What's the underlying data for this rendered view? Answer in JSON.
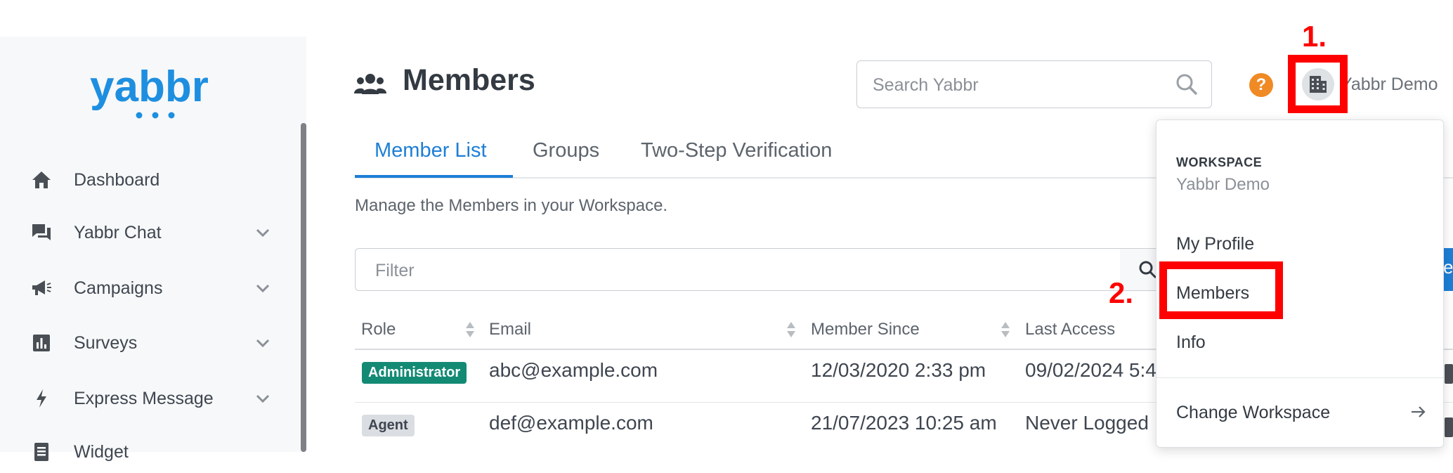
{
  "app": {
    "logo_text": "yabbr"
  },
  "sidebar": {
    "items": [
      {
        "label": "Dashboard",
        "icon": "home-icon",
        "has_chevron": false
      },
      {
        "label": "Yabbr Chat",
        "icon": "chat-icon",
        "has_chevron": true
      },
      {
        "label": "Campaigns",
        "icon": "megaphone-icon",
        "has_chevron": true
      },
      {
        "label": "Surveys",
        "icon": "bar-chart-icon",
        "has_chevron": true
      },
      {
        "label": "Express Message",
        "icon": "lightning-icon",
        "has_chevron": true
      },
      {
        "label": "Widget",
        "icon": "document-icon",
        "has_chevron": false
      }
    ]
  },
  "header": {
    "title": "Members",
    "search_placeholder": "Search Yabbr",
    "help_glyph": "?",
    "workspace_name": "Yabbr Demo"
  },
  "tabs": [
    {
      "label": "Member List",
      "active": true
    },
    {
      "label": "Groups",
      "active": false
    },
    {
      "label": "Two-Step Verification",
      "active": false
    }
  ],
  "description": "Manage the Members in your Workspace.",
  "filter": {
    "placeholder": "Filter",
    "action_label_partial": "e"
  },
  "table": {
    "columns": [
      "Role",
      "Email",
      "Member Since",
      "Last Access"
    ],
    "rows": [
      {
        "role": "Administrator",
        "email": "abc@example.com",
        "member_since": "12/03/2020 2:33 pm",
        "last_access": "09/02/2024 5:4"
      },
      {
        "role": "Agent",
        "email": "def@example.com",
        "member_since": "21/07/2023 10:25 am",
        "last_access": "Never Logged"
      }
    ]
  },
  "dropdown": {
    "section_label": "WORKSPACE",
    "workspace_name": "Yabbr Demo",
    "items": [
      "My Profile",
      "Members",
      "Info"
    ],
    "change_workspace": "Change Workspace"
  },
  "annotations": {
    "step1": "1.",
    "step2": "2.",
    "color": "#ff0000"
  },
  "colors": {
    "accent": "#1d7fd6",
    "admin_badge": "#138a74",
    "help": "#f08a24"
  }
}
